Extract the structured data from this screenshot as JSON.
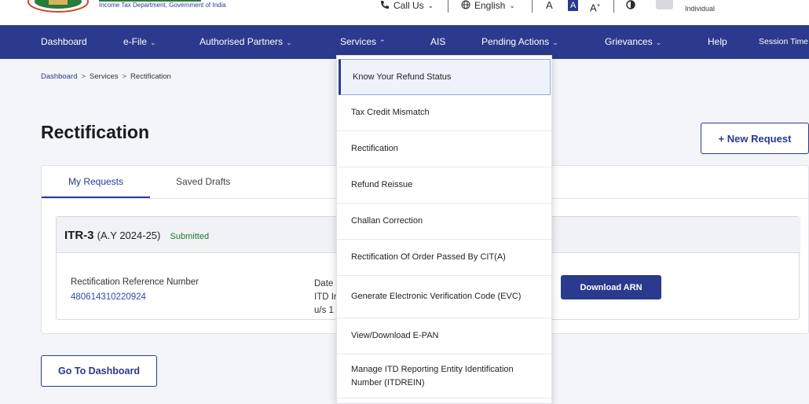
{
  "header": {
    "dept_subtitle": "Income Tax Department, Government of India",
    "call_label": "Call Us",
    "language_label": "English",
    "font_small": "A",
    "font_normal": "A",
    "font_large": "A",
    "font_large_sup": "+",
    "role_label": "Individual"
  },
  "nav": {
    "items": [
      {
        "label": "Dashboard",
        "chevron": false
      },
      {
        "label": "e-File",
        "chevron": true
      },
      {
        "label": "Authorised Partners",
        "chevron": true
      },
      {
        "label": "Services",
        "chevron": true
      },
      {
        "label": "AIS",
        "chevron": false
      },
      {
        "label": "Pending Actions",
        "chevron": true
      },
      {
        "label": "Grievances",
        "chevron": true
      },
      {
        "label": "Help",
        "chevron": false
      },
      {
        "label": "Session Time",
        "chevron": false
      }
    ]
  },
  "breadcrumb": {
    "home": "Dashboard",
    "level1": "Services",
    "current": "Rectification",
    "separator": ">"
  },
  "page": {
    "title": "Rectification",
    "new_request_label": "+ New Request",
    "go_dashboard_label": "Go To Dashboard"
  },
  "tabs": {
    "my_requests": "My Requests",
    "saved_drafts": "Saved Drafts"
  },
  "request": {
    "form": "ITR-3",
    "assessment_year": "(A.Y 2024-25)",
    "status": "Submitted",
    "ref_label": "Rectification Reference Number",
    "ref_value": "480614310220924",
    "date_col_line1": "Date",
    "date_col_line2": "ITD In",
    "date_col_line3": "u/s 1",
    "download_label": "Download ARN"
  },
  "services_menu": {
    "items": [
      "Know Your Refund Status",
      "Tax Credit Mismatch",
      "Rectification",
      "Refund Reissue",
      "Challan Correction",
      "Rectification Of Order Passed By CIT(A)",
      "Generate Electronic Verification Code (EVC)",
      "View/Download E-PAN",
      "Manage ITD Reporting Entity Identification Number (ITDREIN)"
    ]
  },
  "colors": {
    "nav_bg": "#2b3a8c",
    "accent": "#2b3a8c",
    "status_green": "#1e7a2e",
    "link_blue": "#2b4fb5"
  }
}
